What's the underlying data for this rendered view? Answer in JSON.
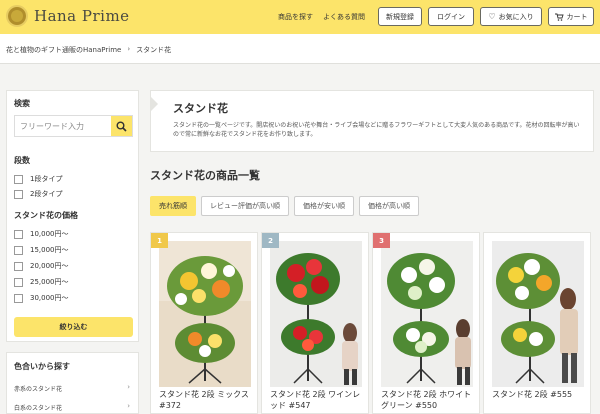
{
  "header": {
    "logo_text": "Hana Prime",
    "nav": [
      "商品を探す",
      "よくある質問"
    ],
    "signup": "新規登録",
    "login": "ログイン",
    "favorites": "お気に入り",
    "cart": "カート"
  },
  "breadcrumb": [
    "花と植物のギフト通販のHanaPrime",
    "スタンド花"
  ],
  "sidebar": {
    "search_heading": "検索",
    "search_placeholder": "フリーワード入力",
    "tiers_heading": "段数",
    "tiers": [
      "1段タイプ",
      "2段タイプ"
    ],
    "price_heading": "スタンド花の価格",
    "prices": [
      "10,000円～",
      "15,000円～",
      "20,000円～",
      "25,000円～",
      "30,000円～"
    ],
    "submit_label": "絞り込む",
    "color_heading": "色合いから探す",
    "colors": [
      "赤系のスタンド花",
      "白系のスタンド花"
    ]
  },
  "intro": {
    "title": "スタンド花",
    "description": "スタンド花の一覧ページです。開店祝いのお祝い花や舞台・ライブ会場などに贈るフラワーギフトとして大変人気のある商品です。花材の回転率が高いので常に新鮮なお花でスタンド花をお作り致します。"
  },
  "list": {
    "title": "スタンド花の商品一覧",
    "sort_tabs": [
      "売れ筋順",
      "レビュー評価が高い順",
      "価格が安い順",
      "価格が高い順"
    ],
    "active_tab": 0
  },
  "products": [
    {
      "rank": "1",
      "rank_color": "#f0c84a",
      "name": "スタンド花 2段 ミックス #372"
    },
    {
      "rank": "2",
      "rank_color": "#9fb8c4",
      "name": "スタンド花 2段 ワインレッド #547"
    },
    {
      "rank": "3",
      "rank_color": "#e07070",
      "name": "スタンド花 2段 ホワイトグリーン #550"
    },
    {
      "rank": "",
      "rank_color": "",
      "name": "スタンド花 2段 #555"
    }
  ],
  "colors": {
    "accent": "#fce46a",
    "background": "#f4f4f2"
  }
}
